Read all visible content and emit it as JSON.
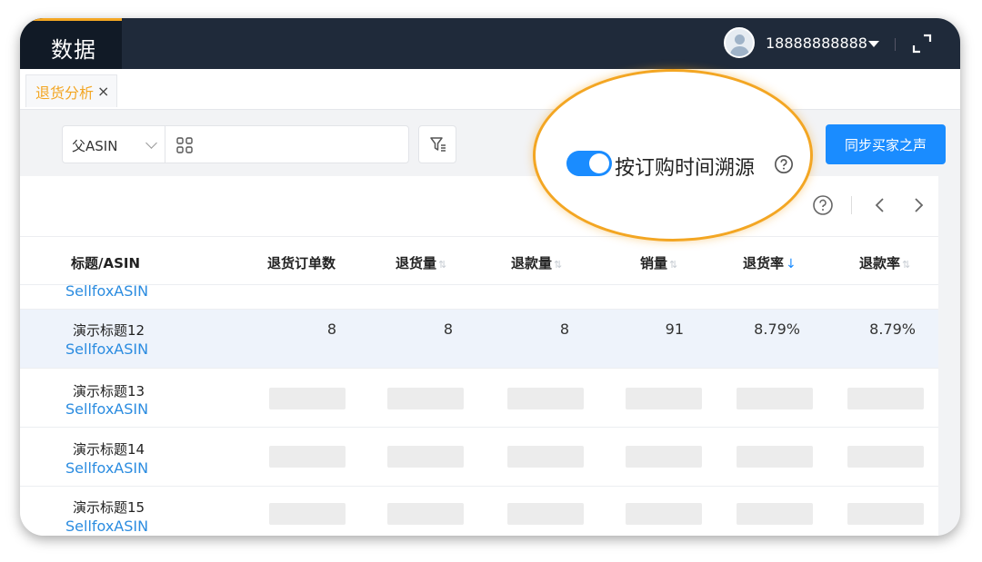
{
  "topbar": {
    "logo_text": "数据",
    "user_phone": "18888888888"
  },
  "tabs": [
    {
      "label": "退货分析",
      "close": "×"
    }
  ],
  "filters": {
    "select_value": "父ASIN",
    "search_placeholder": "",
    "sync_button": "同步买家之声"
  },
  "toggle": {
    "label": "按订购时间溯源",
    "state": "on"
  },
  "table": {
    "headers": [
      "标题/ASIN",
      "退货订单数",
      "退货量",
      "退款量",
      "销量",
      "退货率",
      "退款率"
    ],
    "sorted_column": "退货率",
    "sort_direction": "desc",
    "rows": [
      {
        "title": "",
        "asin": "SellfoxASIN",
        "cells": []
      },
      {
        "title": "演示标题12",
        "asin": "SellfoxASIN",
        "cells": [
          "8",
          "8",
          "8",
          "91",
          "8.79%",
          "8.79%"
        ]
      },
      {
        "title": "演示标题13",
        "asin": "SellfoxASIN",
        "cells": []
      },
      {
        "title": "演示标题14",
        "asin": "SellfoxASIN",
        "cells": []
      },
      {
        "title": "演示标题15",
        "asin": "SellfoxASIN",
        "cells": []
      }
    ]
  },
  "colors": {
    "accent": "#1a8cff",
    "highlight": "#f3a623",
    "topbar": "#1f2a3a",
    "link": "#2b8ce0"
  }
}
